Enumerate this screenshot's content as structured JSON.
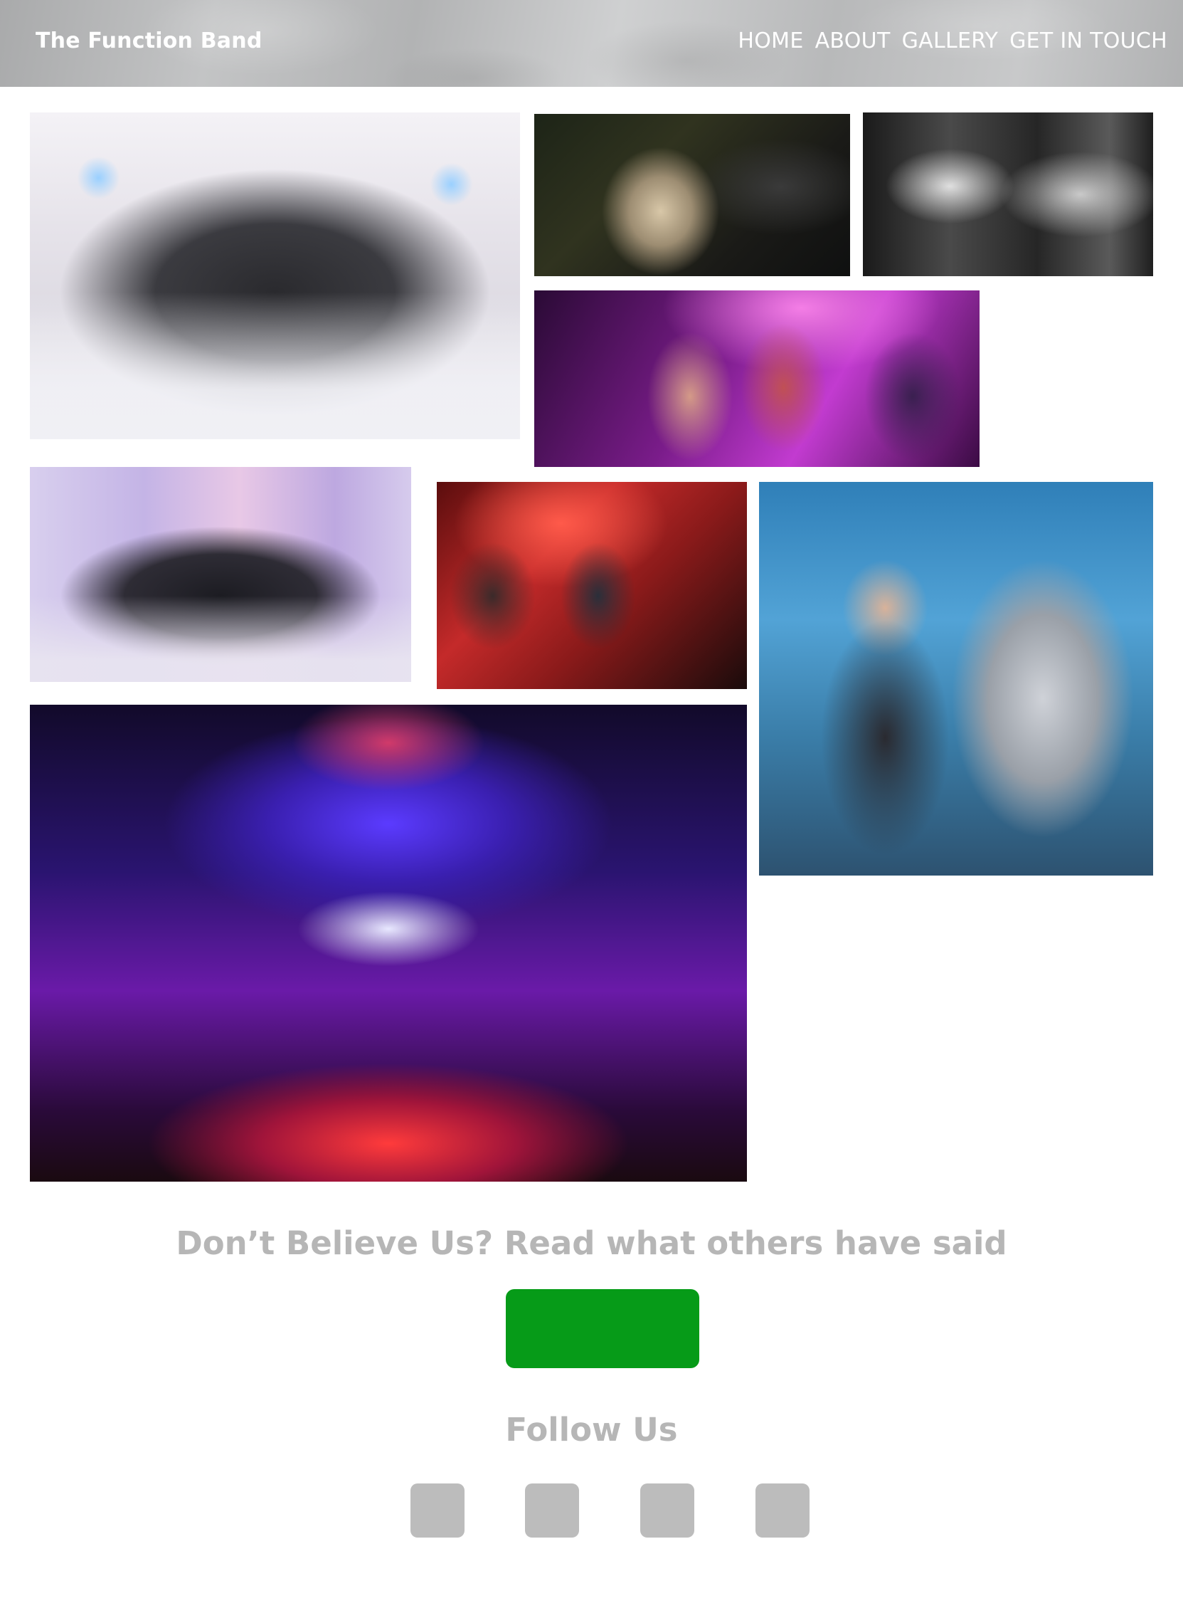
{
  "header": {
    "brand": "The Function Band",
    "nav": [
      "HOME",
      "ABOUT",
      "GALLERY",
      "GET IN TOUCH"
    ]
  },
  "gallery": {
    "photos": [
      {
        "name": "photo-band-white-marquee"
      },
      {
        "name": "photo-couple-dancing"
      },
      {
        "name": "photo-trumpet-players"
      },
      {
        "name": "photo-three-singers"
      },
      {
        "name": "photo-band-purple-stage"
      },
      {
        "name": "photo-trombone-red-stage"
      },
      {
        "name": "photo-guitarist-mirror-man"
      },
      {
        "name": "photo-ballroom-party"
      }
    ]
  },
  "testimonials": {
    "heading": "Don’t Believe Us? Read what others have said",
    "button_color": "#069b18"
  },
  "follow": {
    "heading": "Follow Us",
    "icons": [
      "social-icon-1",
      "social-icon-2",
      "social-icon-3",
      "social-icon-4"
    ]
  }
}
